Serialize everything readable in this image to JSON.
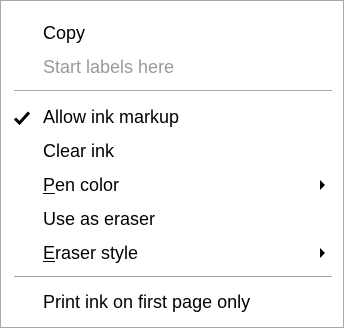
{
  "menu": {
    "items": [
      {
        "label": "Copy",
        "enabled": true
      },
      {
        "label": "Start labels here",
        "enabled": false
      },
      {
        "label": "Allow ink markup",
        "enabled": true,
        "checked": true
      },
      {
        "label": "Clear ink",
        "enabled": true
      },
      {
        "label_mnemonic": "P",
        "label_rest": "en color",
        "enabled": true,
        "submenu": true
      },
      {
        "label": "Use as eraser",
        "enabled": true
      },
      {
        "label_mnemonic": "E",
        "label_rest": "raser style",
        "enabled": true,
        "submenu": true
      },
      {
        "label": "Print ink on first page only",
        "enabled": true
      }
    ]
  },
  "colors": {
    "border": "#a7a7a7",
    "disabled_text": "#9a9a9a",
    "text": "#000000",
    "background": "#ffffff"
  },
  "icons": {
    "checkmark": "check-icon",
    "submenu_arrow": "submenu-arrow-icon"
  }
}
